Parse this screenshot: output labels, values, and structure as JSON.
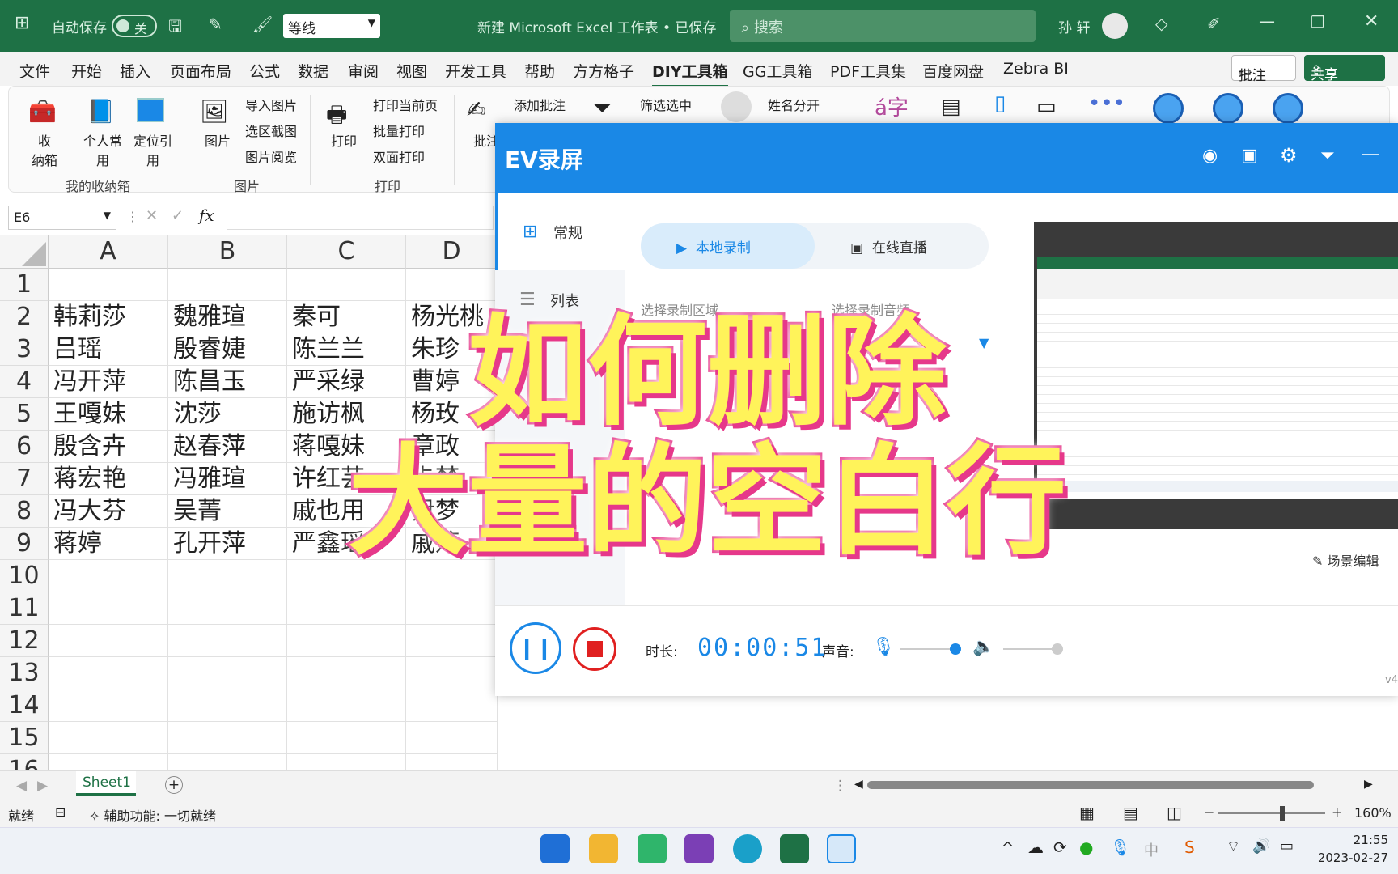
{
  "titlebar": {
    "autosave_label": "自动保存",
    "autosave_state": "关",
    "font_name": "等线",
    "document_title": "新建 Microsoft Excel 工作表 • 已保存",
    "search_placeholder": "搜索",
    "user_name": "孙 轩"
  },
  "menu_tabs": [
    "文件",
    "开始",
    "插入",
    "页面布局",
    "公式",
    "数据",
    "审阅",
    "视图",
    "开发工具",
    "帮助",
    "方方格子",
    "DIY工具箱",
    "GG工具箱",
    "PDF工具集",
    "百度网盘",
    "Zebra BI"
  ],
  "active_tab": "DIY工具箱",
  "ribbon_right": {
    "comment": "批注",
    "share": "共享"
  },
  "ribbon": {
    "storage_btn": "收\n纳箱",
    "personal_btn": "个人常\n用",
    "locate_btn": "定位引\n用",
    "group1": "我的收纳箱",
    "image_btn": "图片",
    "import_image": "导入图片",
    "select_capture": "选区截图",
    "image_view": "图片阅览",
    "group2": "图片",
    "print_btn": "打印",
    "print_current": "打印当前页",
    "batch_print": "批量打印",
    "duplex_print": "双面打印",
    "group3": "打印",
    "comment_btn": "批注",
    "add_comment": "添加批注",
    "filter_selected": "筛选选中",
    "split_name": "姓名分开",
    "char_icon_text": "á字"
  },
  "formula_bar": {
    "name_box": "E6",
    "fx": "fx",
    "value": ""
  },
  "columns": [
    "A",
    "B",
    "C",
    "D"
  ],
  "rows": [
    "1",
    "2",
    "3",
    "4",
    "5",
    "6",
    "7",
    "8",
    "9",
    "10",
    "11",
    "12",
    "13",
    "14",
    "15",
    "16"
  ],
  "cells": [
    [
      "",
      "",
      "",
      ""
    ],
    [
      "韩莉莎",
      "魏雅瑄",
      "秦可",
      "杨光桃"
    ],
    [
      "吕瑶",
      "殷睿婕",
      "陈兰兰",
      "朱珍"
    ],
    [
      "冯开萍",
      "陈昌玉",
      "严采绿",
      "曹婷"
    ],
    [
      "王嘎妹",
      "沈莎",
      "施访枫",
      "杨玫"
    ],
    [
      "殷含卉",
      "赵春萍",
      "蒋嘎妹",
      "章政"
    ],
    [
      "蒋宏艳",
      "冯雅瑄",
      "许红芸",
      "卡梦"
    ],
    [
      "冯大芬",
      "吴菁",
      "戚也用",
      "尹梦"
    ],
    [
      "蒋婷",
      "孔开萍",
      "严鑫瑶",
      "戚婷"
    ]
  ],
  "sheet_tab": "Sheet1",
  "statusbar": {
    "ready": "就绪",
    "accessibility": "辅助功能: 一切就绪",
    "zoom": "160%"
  },
  "ev": {
    "title": "EV录屏",
    "nav_general": "常规",
    "nav_list": "列表",
    "tab_local": "本地录制",
    "tab_live": "在线直播",
    "select_area": "选择录制区域",
    "select_audio": "选择录制音频",
    "scene_edit": "场景编辑",
    "duration_label": "时长:",
    "duration": "00:00:51",
    "sound_label": "声音:",
    "version": "v4"
  },
  "overlay": {
    "line1": "如何删除",
    "line2": "大量的空白行"
  },
  "taskbar": {
    "time": "21:55",
    "date": "2023-02-27",
    "ime": "中"
  },
  "colors": {
    "excel_green": "#1e7145",
    "ev_blue": "#1a88e6",
    "overlay_fill": "#fff35a",
    "overlay_stroke": "#e6388a"
  }
}
